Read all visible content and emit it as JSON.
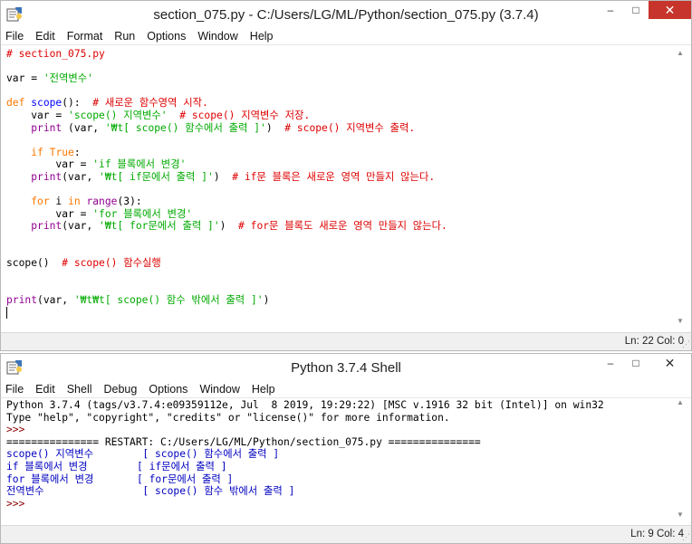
{
  "editor": {
    "title": "section_075.py - C:/Users/LG/ML/Python/section_075.py (3.7.4)",
    "menu": [
      "File",
      "Edit",
      "Format",
      "Run",
      "Options",
      "Window",
      "Help"
    ],
    "code": [
      {
        "tokens": [
          {
            "t": "com",
            "v": "# section_075.py"
          }
        ]
      },
      {
        "tokens": []
      },
      {
        "tokens": [
          {
            "t": "",
            "v": "var = "
          },
          {
            "t": "str",
            "v": "'전역변수'"
          }
        ]
      },
      {
        "tokens": []
      },
      {
        "tokens": [
          {
            "t": "kw",
            "v": "def"
          },
          {
            "t": "",
            "v": " "
          },
          {
            "t": "def",
            "v": "scope"
          },
          {
            "t": "",
            "v": "():  "
          },
          {
            "t": "com",
            "v": "# 새로운 함수영역 시작."
          }
        ]
      },
      {
        "tokens": [
          {
            "t": "",
            "v": "    var = "
          },
          {
            "t": "str",
            "v": "'scope() 지역변수'"
          },
          {
            "t": "",
            "v": "  "
          },
          {
            "t": "com",
            "v": "# scope() 지역변수 저장."
          }
        ]
      },
      {
        "tokens": [
          {
            "t": "",
            "v": "    "
          },
          {
            "t": "blt",
            "v": "print"
          },
          {
            "t": "",
            "v": " (var, "
          },
          {
            "t": "str",
            "v": "'₩t[ scope() 함수에서 출력 ]'"
          },
          {
            "t": "",
            "v": ")  "
          },
          {
            "t": "com",
            "v": "# scope() 지역변수 출력."
          }
        ]
      },
      {
        "tokens": []
      },
      {
        "tokens": [
          {
            "t": "",
            "v": "    "
          },
          {
            "t": "kw",
            "v": "if"
          },
          {
            "t": "",
            "v": " "
          },
          {
            "t": "kw",
            "v": "True"
          },
          {
            "t": "",
            "v": ":"
          }
        ]
      },
      {
        "tokens": [
          {
            "t": "",
            "v": "        var = "
          },
          {
            "t": "str",
            "v": "'if 블록에서 변경'"
          }
        ]
      },
      {
        "tokens": [
          {
            "t": "",
            "v": "    "
          },
          {
            "t": "blt",
            "v": "print"
          },
          {
            "t": "",
            "v": "(var, "
          },
          {
            "t": "str",
            "v": "'₩t[ if문에서 출력 ]'"
          },
          {
            "t": "",
            "v": ")  "
          },
          {
            "t": "com",
            "v": "# if문 블록은 새로운 영역 만들지 않는다."
          }
        ]
      },
      {
        "tokens": []
      },
      {
        "tokens": [
          {
            "t": "",
            "v": "    "
          },
          {
            "t": "kw",
            "v": "for"
          },
          {
            "t": "",
            "v": " i "
          },
          {
            "t": "kw",
            "v": "in"
          },
          {
            "t": "",
            "v": " "
          },
          {
            "t": "blt",
            "v": "range"
          },
          {
            "t": "",
            "v": "(3):"
          }
        ]
      },
      {
        "tokens": [
          {
            "t": "",
            "v": "        var = "
          },
          {
            "t": "str",
            "v": "'for 블록에서 변경'"
          }
        ]
      },
      {
        "tokens": [
          {
            "t": "",
            "v": "    "
          },
          {
            "t": "blt",
            "v": "print"
          },
          {
            "t": "",
            "v": "(var, "
          },
          {
            "t": "str",
            "v": "'₩t[ for문에서 출력 ]'"
          },
          {
            "t": "",
            "v": ")  "
          },
          {
            "t": "com",
            "v": "# for문 블록도 새로운 영역 만들지 않는다."
          }
        ]
      },
      {
        "tokens": []
      },
      {
        "tokens": []
      },
      {
        "tokens": [
          {
            "t": "",
            "v": "scope()  "
          },
          {
            "t": "com",
            "v": "# scope() 함수실행"
          }
        ]
      },
      {
        "tokens": []
      },
      {
        "tokens": []
      },
      {
        "tokens": [
          {
            "t": "blt",
            "v": "print"
          },
          {
            "t": "",
            "v": "(var, "
          },
          {
            "t": "str",
            "v": "'₩t₩t[ scope() 함수 밖에서 출력 ]'"
          },
          {
            "t": "",
            "v": ")"
          }
        ]
      },
      {
        "tokens": [
          {
            "t": "cursor",
            "v": ""
          }
        ]
      }
    ],
    "status": "Ln: 22  Col: 0"
  },
  "shell": {
    "title": "Python 3.7.4 Shell",
    "menu": [
      "File",
      "Edit",
      "Shell",
      "Debug",
      "Options",
      "Window",
      "Help"
    ],
    "lines": [
      {
        "tokens": [
          {
            "t": "",
            "v": "Python 3.7.4 (tags/v3.7.4:e09359112e, Jul  8 2019, 19:29:22) [MSC v.1916 32 bit (Intel)] on win32"
          }
        ]
      },
      {
        "tokens": [
          {
            "t": "",
            "v": "Type \"help\", \"copyright\", \"credits\" or \"license()\" for more information."
          }
        ]
      },
      {
        "tokens": [
          {
            "t": "prompt",
            "v": ">>>"
          }
        ]
      },
      {
        "tokens": [
          {
            "t": "",
            "v": "=============== RESTART: C:/Users/LG/ML/Python/section_075.py ==============="
          }
        ]
      },
      {
        "tokens": [
          {
            "t": "out",
            "v": "scope() 지역변수        [ scope() 함수에서 출력 ]"
          }
        ]
      },
      {
        "tokens": [
          {
            "t": "out",
            "v": "if 블록에서 변경        [ if문에서 출력 ]"
          }
        ]
      },
      {
        "tokens": [
          {
            "t": "out",
            "v": "for 블록에서 변경       [ for문에서 출력 ]"
          }
        ]
      },
      {
        "tokens": [
          {
            "t": "out",
            "v": "전역변수                [ scope() 함수 밖에서 출력 ]"
          }
        ]
      },
      {
        "tokens": [
          {
            "t": "prompt",
            "v": ">>>"
          }
        ]
      }
    ],
    "status": "Ln: 9  Col: 4"
  },
  "colors": {
    "keyword": "#ff7700",
    "string": "#00aa00",
    "comment": "#dd0000",
    "builtin": "#900090",
    "definition": "#0000ff",
    "output": "#0000c0",
    "close_button": "#c7342b"
  },
  "icons": {
    "app": "python-idle-icon",
    "minimize": "minimize-icon",
    "maximize": "maximize-icon",
    "close": "close-icon"
  }
}
